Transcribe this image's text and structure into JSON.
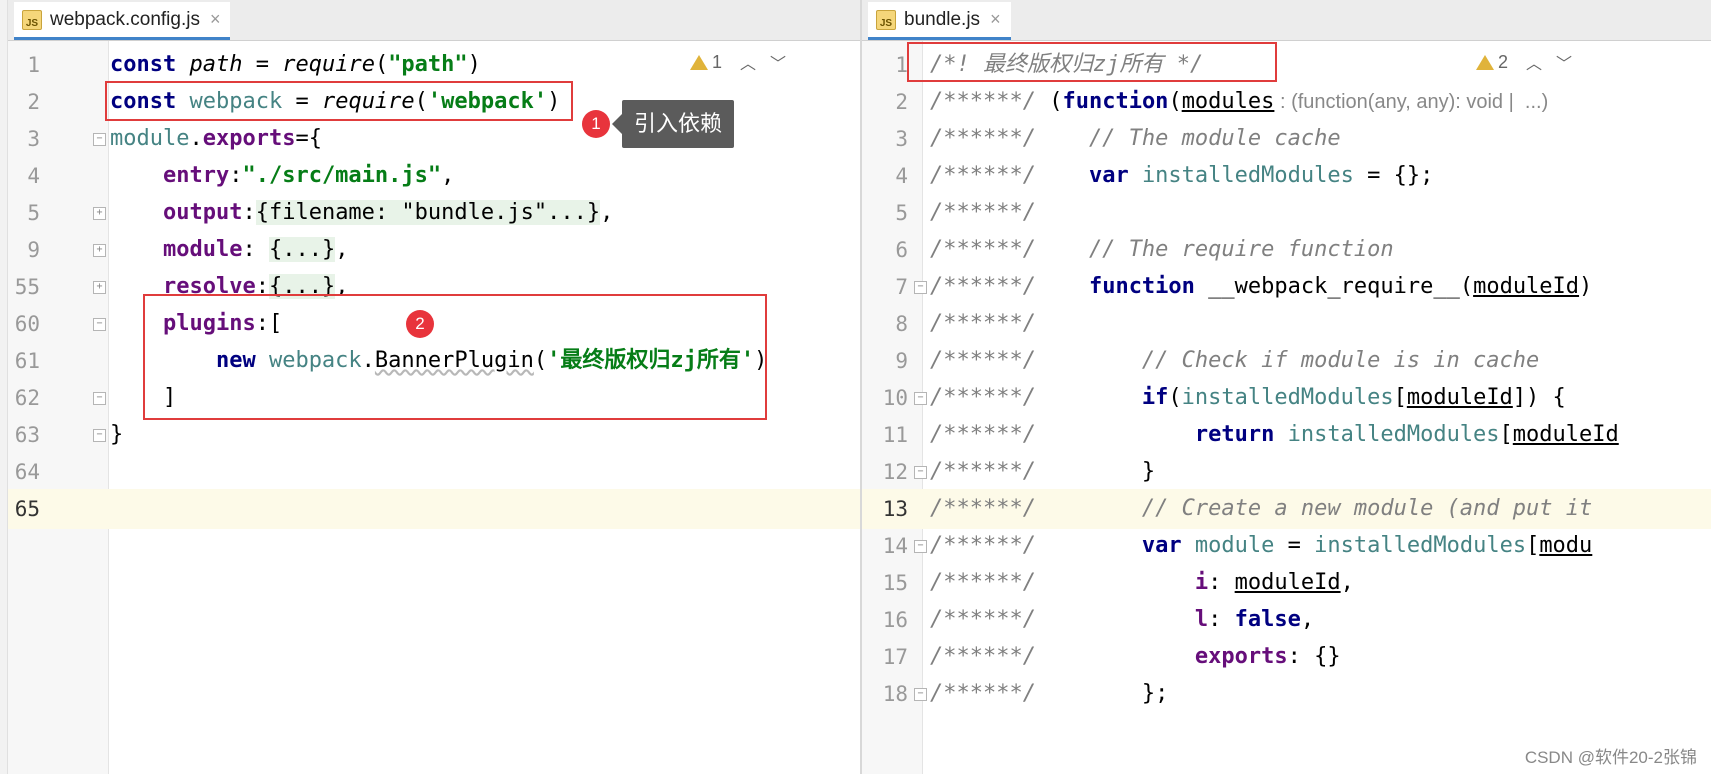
{
  "left_tab": {
    "filename": "webpack.config.js",
    "icon": "js-file-icon"
  },
  "right_tab": {
    "filename": "bundle.js",
    "icon": "js-file-icon"
  },
  "left_inspections": {
    "warnings": "1"
  },
  "right_inspections": {
    "warnings": "2"
  },
  "left_lines": [
    {
      "num": "1",
      "tokens": [
        [
          "kw",
          "const "
        ],
        [
          "fn",
          "path"
        ],
        [
          "",
          ""
        ],
        [
          "",
          " = "
        ],
        [
          "fn",
          "require"
        ],
        [
          "",
          "("
        ],
        [
          "str",
          "\"path\""
        ],
        [
          "",
          ")"
        ]
      ]
    },
    {
      "num": "2",
      "tokens": [
        [
          "kw",
          "const "
        ],
        [
          "var",
          "webpack"
        ],
        [
          "",
          " = "
        ],
        [
          "fn",
          "require"
        ],
        [
          "",
          "("
        ],
        [
          "str",
          "'webpack'"
        ],
        [
          "",
          ")"
        ]
      ]
    },
    {
      "num": "3",
      "tokens": [
        [
          "var",
          "module"
        ],
        [
          "",
          "."
        ],
        [
          "prop",
          "exports"
        ],
        [
          "",
          "={"
        ]
      ]
    },
    {
      "num": "4",
      "tokens": [
        [
          "",
          "    "
        ],
        [
          "prop",
          "entry"
        ],
        [
          "",
          ":"
        ],
        [
          "str",
          "\"./src/main.js\""
        ],
        [
          "",
          ","
        ]
      ]
    },
    {
      "num": "5",
      "tokens": [
        [
          "",
          "    "
        ],
        [
          "prop",
          "output"
        ],
        [
          "",
          ":"
        ],
        [
          "folded",
          "{filename: \"bundle.js\"...}"
        ],
        [
          "",
          ","
        ]
      ]
    },
    {
      "num": "9",
      "tokens": [
        [
          "",
          "    "
        ],
        [
          "prop",
          "module"
        ],
        [
          "",
          ": "
        ],
        [
          "folded",
          "{...}"
        ],
        [
          "",
          ","
        ]
      ]
    },
    {
      "num": "55",
      "tokens": [
        [
          "",
          "    "
        ],
        [
          "prop",
          "resolve"
        ],
        [
          "",
          ":"
        ],
        [
          "folded",
          "{...}"
        ],
        [
          "",
          ","
        ]
      ]
    },
    {
      "num": "60",
      "tokens": [
        [
          "",
          "    "
        ],
        [
          "prop",
          "plugins"
        ],
        [
          "",
          ":["
        ]
      ]
    },
    {
      "num": "61",
      "tokens": [
        [
          "",
          "        "
        ],
        [
          "kw",
          "new "
        ],
        [
          "var",
          "webpack"
        ],
        [
          "",
          "."
        ],
        [
          "wavy",
          "BannerPlugin"
        ],
        [
          "",
          "("
        ],
        [
          "str",
          "'最终版权归zj所有'"
        ],
        [
          "",
          ")"
        ]
      ]
    },
    {
      "num": "62",
      "tokens": [
        [
          "",
          "    ]"
        ]
      ]
    },
    {
      "num": "63",
      "tokens": [
        [
          "",
          "}"
        ]
      ]
    },
    {
      "num": "64",
      "tokens": []
    },
    {
      "num": "65",
      "tokens": []
    }
  ],
  "right_lines": [
    {
      "num": "1",
      "tokens": [
        [
          "cm",
          "/*! 最终版权归zj所有 */"
        ]
      ]
    },
    {
      "num": "2",
      "tokens": [
        [
          "cm",
          "/******/ "
        ],
        [
          "",
          "("
        ],
        [
          "kw",
          "function"
        ],
        [
          "",
          "("
        ],
        [
          "ul",
          "modules"
        ],
        [
          "hint",
          " : (function(any, any): void |  ...) "
        ]
      ]
    },
    {
      "num": "3",
      "tokens": [
        [
          "cm",
          "/******/    // The module cache"
        ]
      ]
    },
    {
      "num": "4",
      "tokens": [
        [
          "cm",
          "/******/    "
        ],
        [
          "kw",
          "var "
        ],
        [
          "var",
          "installedModules"
        ],
        [
          "",
          " = {};"
        ]
      ]
    },
    {
      "num": "5",
      "tokens": [
        [
          "cm",
          "/******/"
        ]
      ]
    },
    {
      "num": "6",
      "tokens": [
        [
          "cm",
          "/******/    // The require function"
        ]
      ]
    },
    {
      "num": "7",
      "tokens": [
        [
          "cm",
          "/******/    "
        ],
        [
          "kw",
          "function "
        ],
        [
          "",
          "__webpack_require__("
        ],
        [
          "ul",
          "moduleId"
        ],
        [
          "",
          ")"
        ]
      ]
    },
    {
      "num": "8",
      "tokens": [
        [
          "cm",
          "/******/"
        ]
      ]
    },
    {
      "num": "9",
      "tokens": [
        [
          "cm",
          "/******/        // Check if module is in cache"
        ]
      ]
    },
    {
      "num": "10",
      "tokens": [
        [
          "cm",
          "/******/        "
        ],
        [
          "kw",
          "if"
        ],
        [
          "",
          "("
        ],
        [
          "var",
          "installedModules"
        ],
        [
          "",
          "["
        ],
        [
          "ul",
          "moduleId"
        ],
        [
          "",
          "]) {"
        ]
      ]
    },
    {
      "num": "11",
      "tokens": [
        [
          "cm",
          "/******/            "
        ],
        [
          "kw",
          "return "
        ],
        [
          "var",
          "installedModules"
        ],
        [
          "",
          "["
        ],
        [
          "ul",
          "moduleId"
        ]
      ]
    },
    {
      "num": "12",
      "tokens": [
        [
          "cm",
          "/******/        "
        ],
        [
          "",
          "}"
        ]
      ]
    },
    {
      "num": "13",
      "tokens": [
        [
          "cm",
          "/******/        // Create a new module (and put it"
        ]
      ]
    },
    {
      "num": "14",
      "tokens": [
        [
          "cm",
          "/******/        "
        ],
        [
          "kw",
          "var "
        ],
        [
          "var",
          "module"
        ],
        [
          "",
          " = "
        ],
        [
          "var",
          "installedModules"
        ],
        [
          "",
          "["
        ],
        [
          "ul",
          "modu"
        ]
      ]
    },
    {
      "num": "15",
      "tokens": [
        [
          "cm",
          "/******/            "
        ],
        [
          "prop",
          "i"
        ],
        [
          "",
          ": "
        ],
        [
          "ul",
          "moduleId"
        ],
        [
          "",
          ","
        ]
      ]
    },
    {
      "num": "16",
      "tokens": [
        [
          "cm",
          "/******/            "
        ],
        [
          "prop",
          "l"
        ],
        [
          "",
          ": "
        ],
        [
          "kw",
          "false"
        ],
        [
          "",
          ","
        ]
      ]
    },
    {
      "num": "17",
      "tokens": [
        [
          "cm",
          "/******/            "
        ],
        [
          "prop",
          "exports"
        ],
        [
          "",
          ": {}"
        ]
      ]
    },
    {
      "num": "18",
      "tokens": [
        [
          "cm",
          "/******/        "
        ],
        [
          "",
          "};"
        ]
      ]
    }
  ],
  "annotations": {
    "badge1": "1",
    "callout1": "引入依赖",
    "badge2": "2"
  },
  "watermark": "CSDN @软件20-2张锦",
  "colors": {
    "annotation_red": "#e03c3c",
    "callout_bg": "#5b5b5b",
    "keyword": "#000080",
    "string": "#067d17"
  }
}
